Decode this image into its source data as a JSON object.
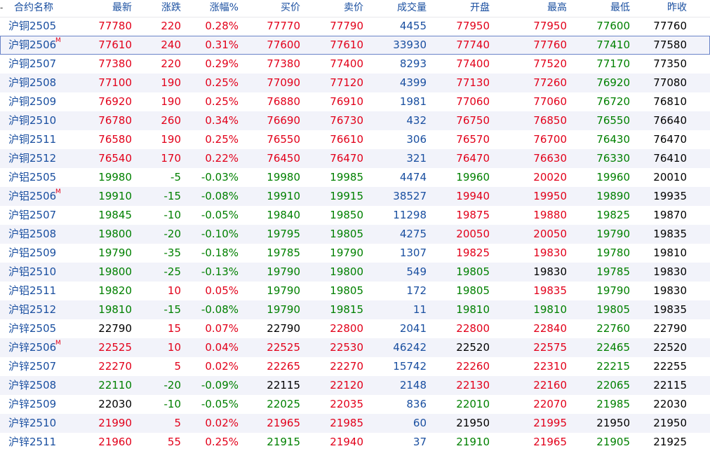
{
  "header": {
    "collapse_glyph": "-",
    "columns": [
      "合约名称",
      "最新",
      "涨跌",
      "涨幅%",
      "买价",
      "卖价",
      "成交量",
      "开盘",
      "最高",
      "最低",
      "昨收"
    ]
  },
  "colors": {
    "up": "#e2001a",
    "down": "#008000",
    "flat": "#000000",
    "name": "#1a4fa0",
    "volume": "#1a4fa0",
    "alt_row": "#f2f3fa"
  },
  "rows": [
    {
      "name": "沪铜2505",
      "flag": "",
      "last": "77780",
      "chg": "220",
      "pct": "0.28%",
      "bid": "77770",
      "ask": "77790",
      "vol": "4455",
      "open": "77950",
      "high": "77950",
      "low": "77600",
      "prev": "77760"
    },
    {
      "name": "沪铜2506",
      "flag": "M",
      "last": "77610",
      "chg": "240",
      "pct": "0.31%",
      "bid": "77600",
      "ask": "77610",
      "vol": "33930",
      "open": "77740",
      "high": "77760",
      "low": "77410",
      "prev": "77580"
    },
    {
      "name": "沪铜2507",
      "flag": "",
      "last": "77380",
      "chg": "220",
      "pct": "0.29%",
      "bid": "77380",
      "ask": "77400",
      "vol": "8293",
      "open": "77400",
      "high": "77520",
      "low": "77170",
      "prev": "77350"
    },
    {
      "name": "沪铜2508",
      "flag": "",
      "last": "77100",
      "chg": "190",
      "pct": "0.25%",
      "bid": "77090",
      "ask": "77120",
      "vol": "4399",
      "open": "77130",
      "high": "77260",
      "low": "76920",
      "prev": "77080"
    },
    {
      "name": "沪铜2509",
      "flag": "",
      "last": "76920",
      "chg": "190",
      "pct": "0.25%",
      "bid": "76880",
      "ask": "76910",
      "vol": "1981",
      "open": "77060",
      "high": "77060",
      "low": "76720",
      "prev": "76810"
    },
    {
      "name": "沪铜2510",
      "flag": "",
      "last": "76780",
      "chg": "260",
      "pct": "0.34%",
      "bid": "76690",
      "ask": "76730",
      "vol": "432",
      "open": "76750",
      "high": "76850",
      "low": "76550",
      "prev": "76640"
    },
    {
      "name": "沪铜2511",
      "flag": "",
      "last": "76580",
      "chg": "190",
      "pct": "0.25%",
      "bid": "76550",
      "ask": "76610",
      "vol": "306",
      "open": "76570",
      "high": "76700",
      "low": "76430",
      "prev": "76470"
    },
    {
      "name": "沪铜2512",
      "flag": "",
      "last": "76540",
      "chg": "170",
      "pct": "0.22%",
      "bid": "76450",
      "ask": "76470",
      "vol": "321",
      "open": "76470",
      "high": "76630",
      "low": "76330",
      "prev": "76410"
    },
    {
      "name": "沪铝2505",
      "flag": "",
      "last": "19980",
      "chg": "-5",
      "pct": "-0.03%",
      "bid": "19980",
      "ask": "19985",
      "vol": "4474",
      "open": "19960",
      "high": "20020",
      "low": "19960",
      "prev": "20010"
    },
    {
      "name": "沪铝2506",
      "flag": "M",
      "last": "19910",
      "chg": "-15",
      "pct": "-0.08%",
      "bid": "19910",
      "ask": "19915",
      "vol": "38527",
      "open": "19940",
      "high": "19950",
      "low": "19890",
      "prev": "19935"
    },
    {
      "name": "沪铝2507",
      "flag": "",
      "last": "19845",
      "chg": "-10",
      "pct": "-0.05%",
      "bid": "19840",
      "ask": "19850",
      "vol": "11298",
      "open": "19875",
      "high": "19880",
      "low": "19825",
      "prev": "19870"
    },
    {
      "name": "沪铝2508",
      "flag": "",
      "last": "19800",
      "chg": "-20",
      "pct": "-0.10%",
      "bid": "19795",
      "ask": "19805",
      "vol": "4275",
      "open": "20050",
      "high": "20050",
      "low": "19790",
      "prev": "19835"
    },
    {
      "name": "沪铝2509",
      "flag": "",
      "last": "19790",
      "chg": "-35",
      "pct": "-0.18%",
      "bid": "19785",
      "ask": "19790",
      "vol": "1307",
      "open": "19825",
      "high": "19830",
      "low": "19780",
      "prev": "19810"
    },
    {
      "name": "沪铝2510",
      "flag": "",
      "last": "19800",
      "chg": "-25",
      "pct": "-0.13%",
      "bid": "19790",
      "ask": "19800",
      "vol": "549",
      "open": "19805",
      "high": "19830",
      "low": "19785",
      "prev": "19830"
    },
    {
      "name": "沪铝2511",
      "flag": "",
      "last": "19820",
      "chg": "10",
      "pct": "0.05%",
      "bid": "19790",
      "ask": "19805",
      "vol": "172",
      "open": "19805",
      "high": "19835",
      "low": "19790",
      "prev": "19830"
    },
    {
      "name": "沪铝2512",
      "flag": "",
      "last": "19810",
      "chg": "-15",
      "pct": "-0.08%",
      "bid": "19790",
      "ask": "19815",
      "vol": "11",
      "open": "19810",
      "high": "19810",
      "low": "19805",
      "prev": "19835"
    },
    {
      "name": "沪锌2505",
      "flag": "",
      "last": "22790",
      "chg": "15",
      "pct": "0.07%",
      "bid": "22790",
      "ask": "22800",
      "vol": "2041",
      "open": "22800",
      "high": "22840",
      "low": "22760",
      "prev": "22790"
    },
    {
      "name": "沪锌2506",
      "flag": "M",
      "last": "22525",
      "chg": "10",
      "pct": "0.04%",
      "bid": "22525",
      "ask": "22530",
      "vol": "46242",
      "open": "22520",
      "high": "22575",
      "low": "22465",
      "prev": "22520"
    },
    {
      "name": "沪锌2507",
      "flag": "",
      "last": "22270",
      "chg": "5",
      "pct": "0.02%",
      "bid": "22265",
      "ask": "22270",
      "vol": "15742",
      "open": "22260",
      "high": "22310",
      "low": "22215",
      "prev": "22255"
    },
    {
      "name": "沪锌2508",
      "flag": "",
      "last": "22110",
      "chg": "-20",
      "pct": "-0.09%",
      "bid": "22115",
      "ask": "22120",
      "vol": "2148",
      "open": "22130",
      "high": "22160",
      "low": "22065",
      "prev": "22115"
    },
    {
      "name": "沪锌2509",
      "flag": "",
      "last": "22030",
      "chg": "-10",
      "pct": "-0.05%",
      "bid": "22025",
      "ask": "22035",
      "vol": "836",
      "open": "22010",
      "high": "22070",
      "low": "21985",
      "prev": "22030"
    },
    {
      "name": "沪锌2510",
      "flag": "",
      "last": "21990",
      "chg": "5",
      "pct": "0.02%",
      "bid": "21965",
      "ask": "21985",
      "vol": "60",
      "open": "21950",
      "high": "21995",
      "low": "21950",
      "prev": "21950"
    },
    {
      "name": "沪锌2511",
      "flag": "",
      "last": "21960",
      "chg": "55",
      "pct": "0.25%",
      "bid": "21915",
      "ask": "21940",
      "vol": "37",
      "open": "21910",
      "high": "21965",
      "low": "21905",
      "prev": "21925"
    }
  ]
}
